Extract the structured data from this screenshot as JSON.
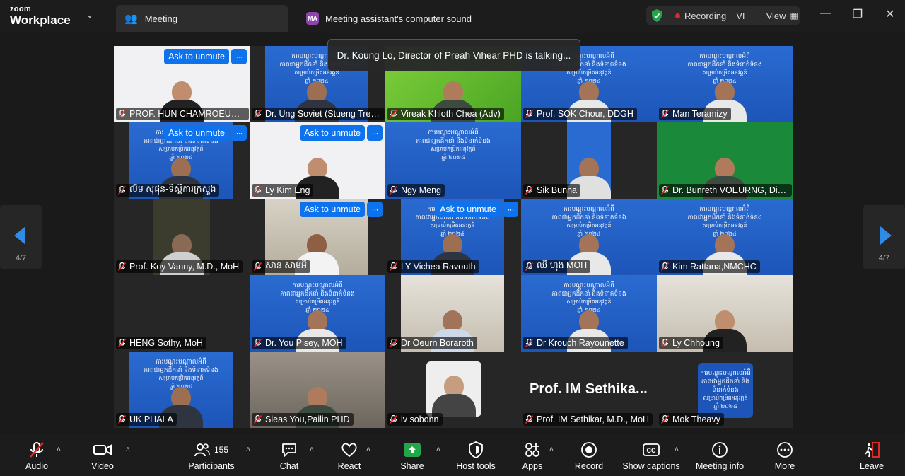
{
  "app": {
    "brand_top": "zoom",
    "brand_bottom": "Workplace"
  },
  "tabs": [
    {
      "label": "Meeting"
    },
    {
      "badge": "MA",
      "label": "Meeting assistant's computer sound"
    }
  ],
  "status": {
    "recording": "Recording",
    "lang": "VI",
    "view": "View"
  },
  "toast": "Dr. Koung Lo, Director of Preah Vihear PHD is talking...",
  "pager": {
    "left": "4/7",
    "right": "4/7"
  },
  "unmute_label": "Ask to unmute",
  "big_name": "Prof. IM Sethika...",
  "banner": {
    "line1": "ការបណ្តុះបណ្តាលអំពី",
    "line2": "ភាពជាអ្នកដឹកនាំ និងទំនាក់ទំនង",
    "line3": "សម្រាប់កម្រិតអនុវត្តន៍",
    "line4": "ឆ្នាំ ២០២៤"
  },
  "participants": [
    "PROF. HUN CHAMROEUN (...",
    "Dr. Ung Soviet (Stueng Tren...",
    "Vireak Khloth Chea (Adv)",
    "Prof. SOK Chour, DDGH",
    "Man Teramizy",
    "ល៊ីម សុផុន-ទីស្តីការក្រសួង",
    "Ly Kim Eng",
    "Ngy Meng",
    "Sik Bunna",
    "Dr. Bunreth VOEURNG, Dire...",
    "Prof. Koy Vanny, M.D., MoH",
    "សាន សាមអី",
    "LY Vichea Ravouth",
    "ឈឹ ហុង MOH",
    "Kim Rattana,NMCHC",
    "HENG Sothy, MoH",
    "Dr. You Pisey, MOH",
    "Dr Oeurn Boraroth",
    "Dr Krouch Rayounette",
    "Ly Chhoung",
    "UK PHALA",
    "Sleas You,Pailin PHD",
    "iv sobonn",
    "Prof. IM Sethikar, M.D., MoH",
    "Mok Theavy"
  ],
  "toolbar": {
    "audio": "Audio",
    "video": "Video",
    "participants": "Participants",
    "participants_count": "155",
    "chat": "Chat",
    "react": "React",
    "share": "Share",
    "host_tools": "Host tools",
    "apps": "Apps",
    "record": "Record",
    "captions": "Show captions",
    "info": "Meeting info",
    "more": "More",
    "leave": "Leave"
  },
  "colors": {
    "accent": "#0e72ed",
    "share": "#23a54a",
    "record": "#e02a2a",
    "leave": "#e02a2a"
  }
}
